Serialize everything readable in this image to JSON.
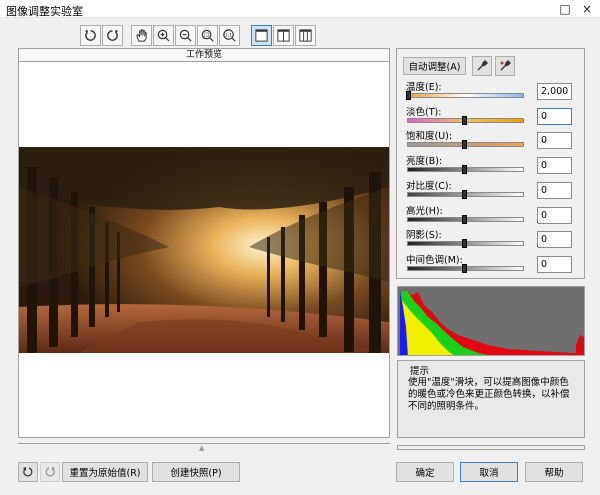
{
  "window": {
    "title": "图像调整实验室",
    "close": "×"
  },
  "toolbar": {
    "rotate_left": "rotate-ccw-icon",
    "rotate_right": "rotate-cw-icon",
    "pan": "hand-icon",
    "zoom_in": "zoom-in-icon",
    "zoom_out": "zoom-out-icon",
    "fit": "zoom-fit-icon",
    "actual": "zoom-100-icon",
    "view_single": "view-single-icon",
    "view_split_v": "view-split-vertical-icon",
    "view_split_h": "view-split-horizontal-icon"
  },
  "preview": {
    "title": "工作预览"
  },
  "panel": {
    "auto_adjust": "自动调整(A)",
    "sliders": [
      {
        "label": "温度(E):",
        "value": "2,000",
        "level": 0.0
      },
      {
        "label": "淡色(T):",
        "value": "0",
        "level": 0.5
      },
      {
        "label": "饱和度(U):",
        "value": "0",
        "level": 0.5
      },
      {
        "label": "亮度(B):",
        "value": "0",
        "level": 0.5
      },
      {
        "label": "对比度(C):",
        "value": "0",
        "level": 0.5
      },
      {
        "label": "高光(H):",
        "value": "0",
        "level": 0.5
      },
      {
        "label": "阴影(S):",
        "value": "0",
        "level": 0.5
      },
      {
        "label": "中间色调(M):",
        "value": "0",
        "level": 0.5
      }
    ]
  },
  "hint": {
    "title": "提示",
    "text": "使用\"温度\"滑块，可以提高图像中颜色的暖色或冷色来更正颜色转换，以补偿不同的照明条件。"
  },
  "footer": {
    "reset": "重置为原始值(R)",
    "snapshot": "创建快照(P)",
    "ok": "确定",
    "cancel": "取消",
    "help": "帮助"
  },
  "colors": {
    "accent": "#3c7fb1",
    "hist_bg": "#6f6f6f"
  }
}
